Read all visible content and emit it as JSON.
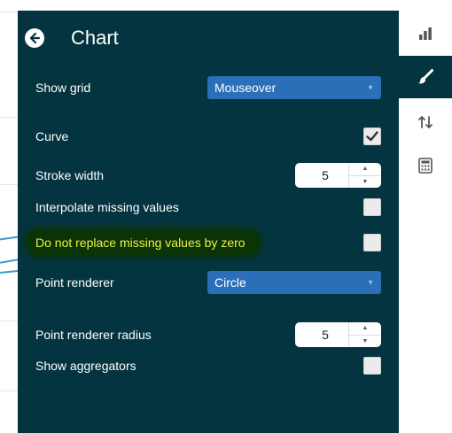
{
  "panel": {
    "title": "Chart",
    "back_icon": "arrow-left-circle-icon"
  },
  "settings": {
    "show_grid": {
      "label": "Show grid",
      "value": "Mouseover"
    },
    "curve": {
      "label": "Curve",
      "checked": true
    },
    "stroke_width": {
      "label": "Stroke width",
      "value": "5"
    },
    "interpolate_missing": {
      "label": "Interpolate missing values",
      "checked": false
    },
    "do_not_replace_missing": {
      "label": "Do not replace missing values by zero",
      "checked": false
    },
    "point_renderer": {
      "label": "Point renderer",
      "value": "Circle"
    },
    "point_renderer_radius": {
      "label": "Point renderer radius",
      "value": "5"
    },
    "show_aggregators": {
      "label": "Show aggregators",
      "checked": false
    }
  },
  "toolbar": {
    "items": [
      {
        "icon": "bar-chart-icon",
        "active": false
      },
      {
        "icon": "paintbrush-icon",
        "active": true
      },
      {
        "icon": "sort-arrows-icon",
        "active": false
      },
      {
        "icon": "calculator-icon",
        "active": false
      }
    ]
  },
  "colors": {
    "panel_bg": "#04343f",
    "select_bg": "#2a6fb8",
    "highlight_text": "#f0f23a",
    "highlight_bg": "#0a3407"
  }
}
